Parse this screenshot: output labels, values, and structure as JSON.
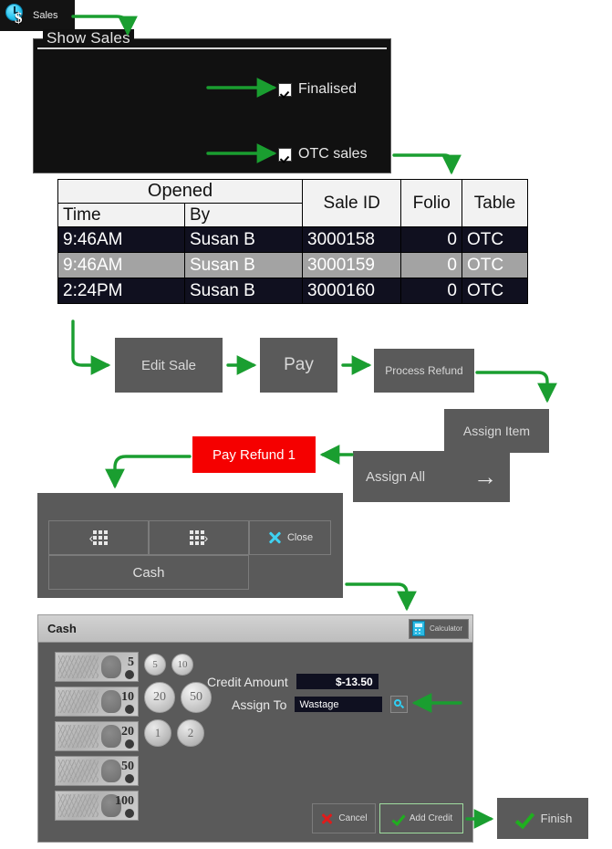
{
  "app": {
    "title": "Sales",
    "title_icon": "clock-dollar-icon"
  },
  "show_sales": {
    "legend": "Show Sales",
    "checkboxes": [
      {
        "label": "Finalised",
        "checked": true
      },
      {
        "label": "OTC sales",
        "checked": true
      }
    ]
  },
  "sales_table": {
    "group_header": "Opened",
    "headers": [
      "Time",
      "By",
      "Sale ID",
      "Folio",
      "Table"
    ],
    "rows": [
      {
        "time": "9:46AM",
        "by": "Susan B",
        "sale_id": "3000158",
        "folio": "0",
        "table": "OTC",
        "selected": false
      },
      {
        "time": "9:46AM",
        "by": "Susan B",
        "sale_id": "3000159",
        "folio": "0",
        "table": "OTC",
        "selected": true
      },
      {
        "time": "2:24PM",
        "by": "Susan B",
        "sale_id": "3000160",
        "folio": "0",
        "table": "OTC",
        "selected": false
      }
    ]
  },
  "workflow_buttons": {
    "edit_sale": "Edit Sale",
    "pay": "Pay",
    "process_refund": "Process Refund",
    "assign_item": "Assign Item",
    "assign_all": "Assign All",
    "assign_all_arrow": "→",
    "pay_refund": "Pay Refund 1"
  },
  "cash_panel": {
    "prev_label": "",
    "next_label": "",
    "close_label": "Close",
    "cash_label": "Cash",
    "prev_icon": "grid-prev-icon",
    "next_icon": "grid-next-icon",
    "close_icon": "close-x-icon"
  },
  "cash_dialog": {
    "title": "Cash",
    "calculator_label": "Calculator",
    "notes": [
      "5",
      "10",
      "20",
      "50",
      "100"
    ],
    "coins": [
      [
        "5",
        "10"
      ],
      [
        "20",
        "50"
      ],
      [
        "1",
        "2"
      ]
    ],
    "fields": {
      "credit_amount_label": "Credit Amount",
      "credit_amount_value": "$-13.50",
      "assign_to_label": "Assign To",
      "assign_to_value": "Wastage",
      "assign_to_search_icon": "magnifier-icon"
    },
    "buttons": {
      "cancel": "Cancel",
      "add_credit": "Add Credit"
    }
  },
  "finish_button": {
    "label": "Finish"
  },
  "colors": {
    "accent_green": "#1a9e30",
    "danger_red": "#f50000",
    "panel_grey": "#5a5a5a",
    "dark_panel": "#111111"
  }
}
